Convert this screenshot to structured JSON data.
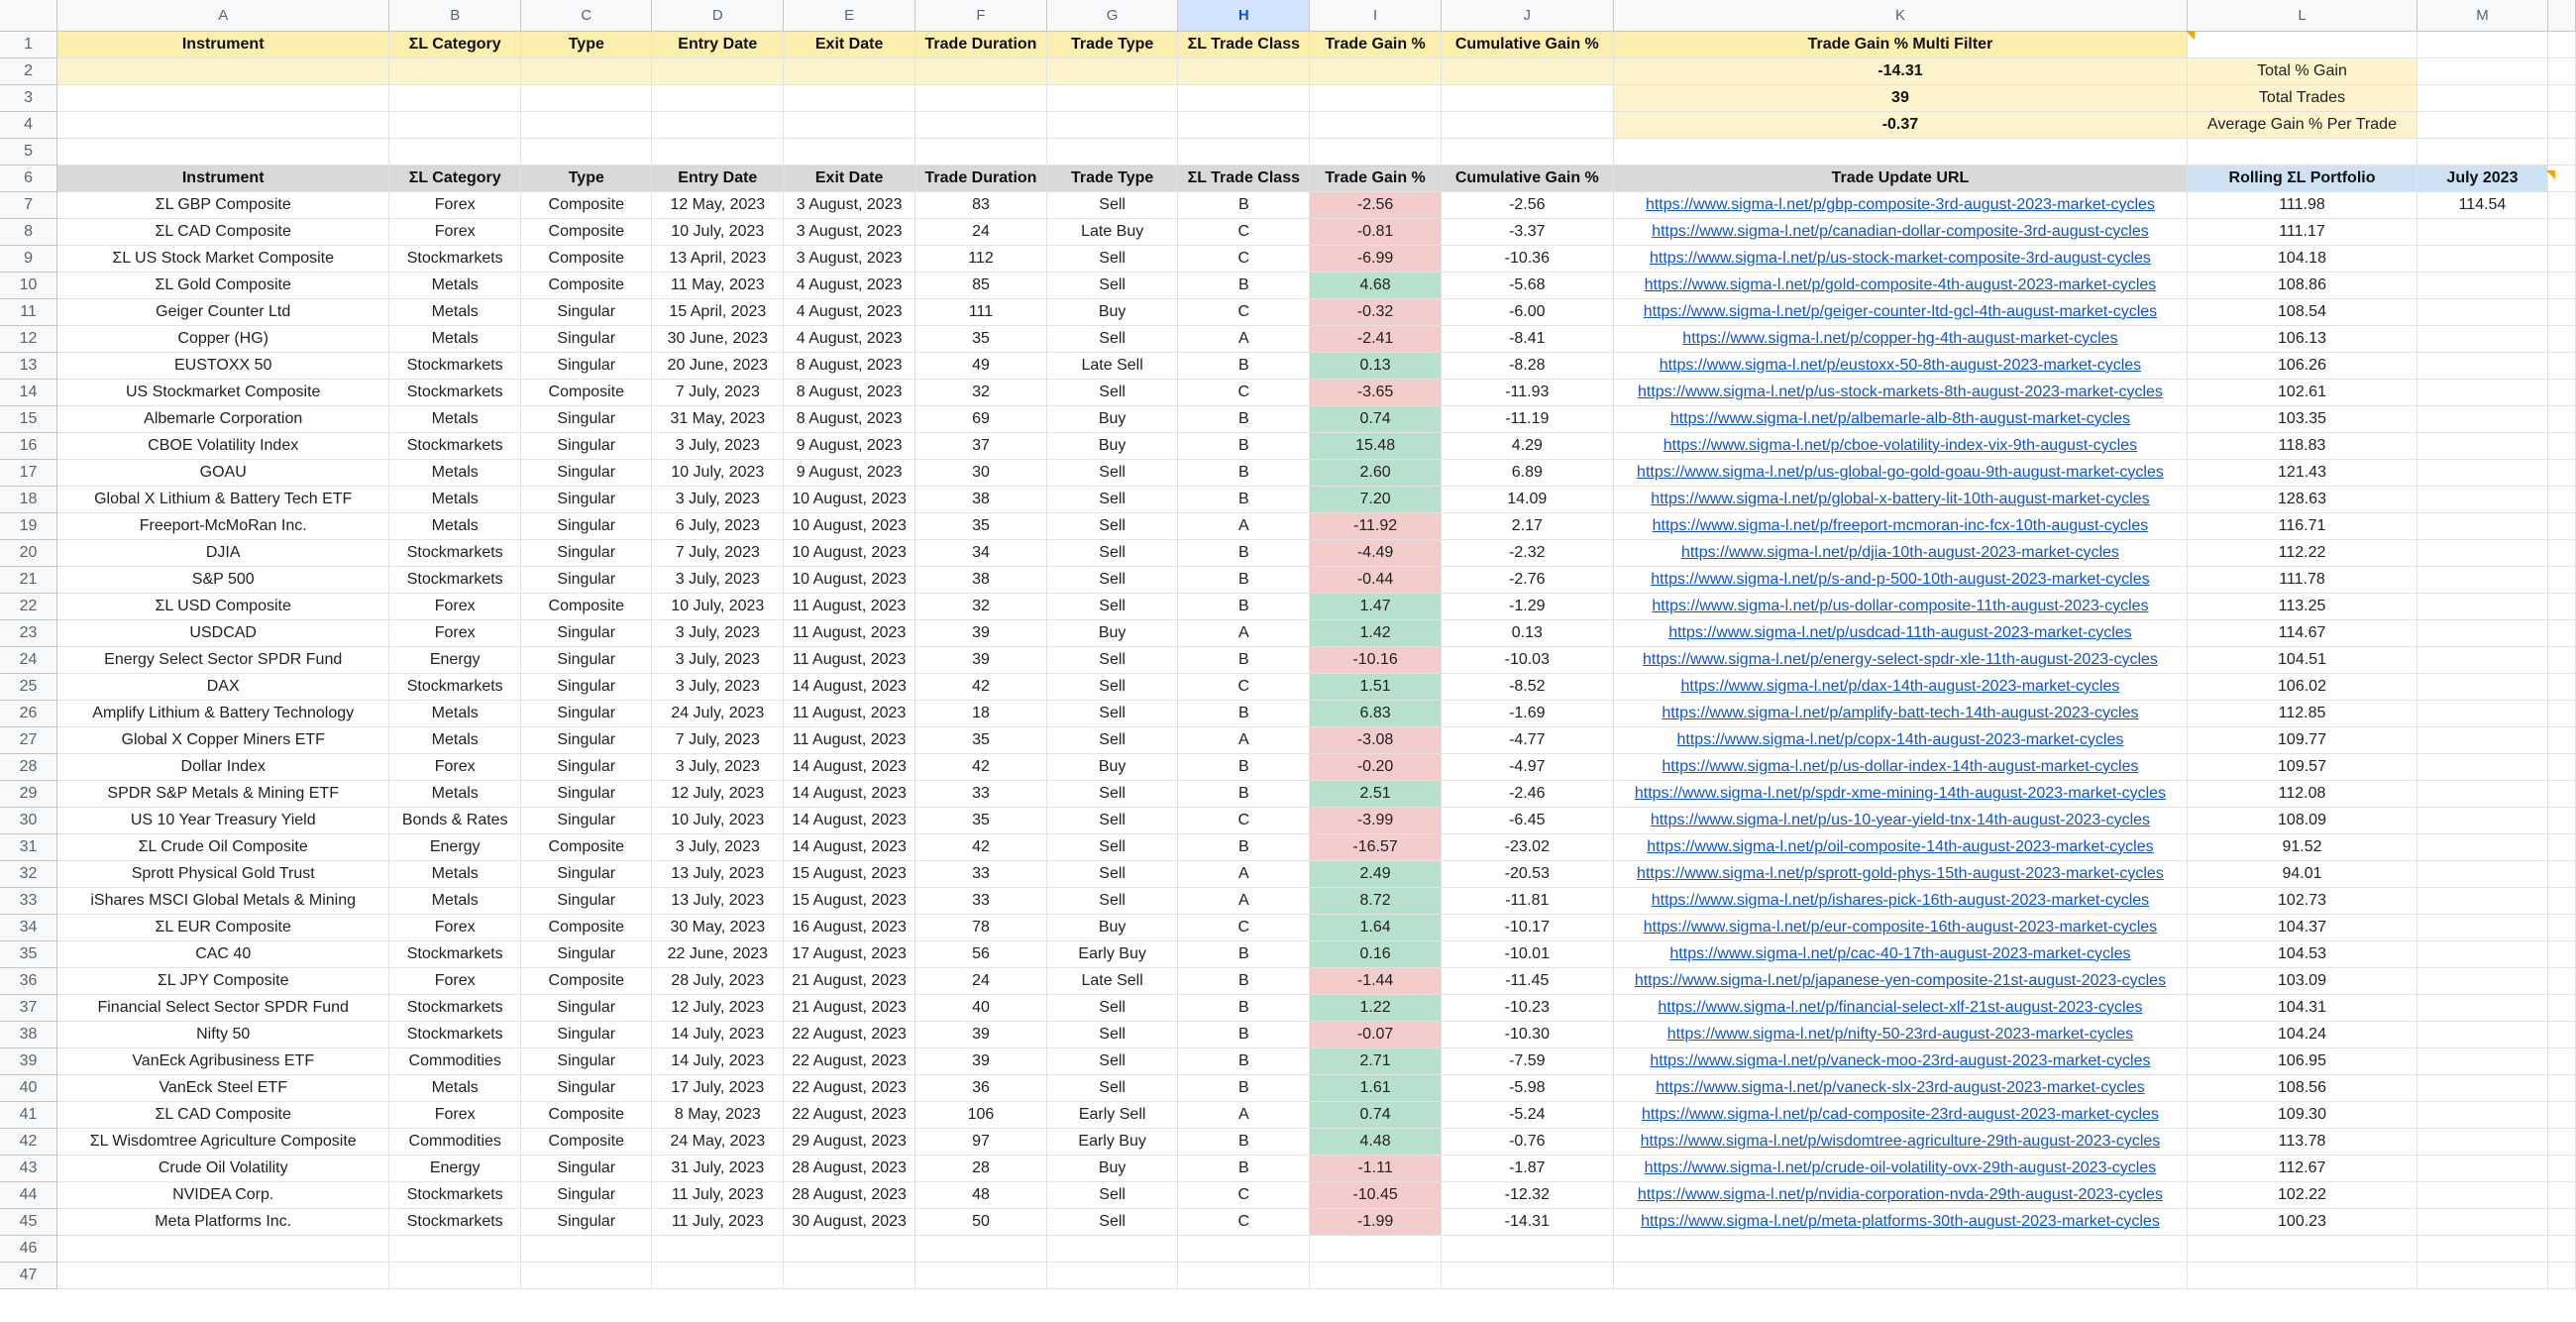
{
  "column_letters": [
    "A",
    "B",
    "C",
    "D",
    "E",
    "F",
    "G",
    "H",
    "I",
    "J",
    "K",
    "L",
    "M"
  ],
  "selected_column": "H",
  "header_row_1": [
    "Instrument",
    "ΣL Category",
    "Type",
    "Entry Date",
    "Exit Date",
    "Trade Duration",
    "Trade Type",
    "ΣL Trade Class",
    "Trade Gain %",
    "Cumulative Gain %",
    "Trade Gain % Multi Filter"
  ],
  "stats": [
    {
      "value": "-14.31",
      "label": "Total % Gain"
    },
    {
      "value": "39",
      "label": "Total Trades"
    },
    {
      "value": "-0.37",
      "label": "Average Gain % Per Trade"
    }
  ],
  "header_row_6": [
    "Instrument",
    "ΣL Category",
    "Type",
    "Entry Date",
    "Exit Date",
    "Trade Duration",
    "Trade Type",
    "ΣL Trade Class",
    "Trade Gain %",
    "Cumulative Gain %",
    "Trade Update URL",
    "Rolling ΣL Portfolio",
    "July 2023"
  ],
  "july_value": "114.54",
  "row_numbers_extra": [
    "46",
    "47"
  ],
  "colors": {
    "positive": "#b7e1cd",
    "negative": "#f4cccc",
    "header_yellow": "#fcefad",
    "link": "#1155cc",
    "selected_col": "#d3e3fd"
  },
  "trades": [
    [
      "ΣL GBP Composite",
      "Forex",
      "Composite",
      "12 May, 2023",
      "3 August, 2023",
      "83",
      "Sell",
      "B",
      "-2.56",
      "-2.56",
      "https://www.sigma-l.net/p/gbp-composite-3rd-august-2023-market-cycles",
      "111.98"
    ],
    [
      "ΣL CAD Composite",
      "Forex",
      "Composite",
      "10 July, 2023",
      "3 August, 2023",
      "24",
      "Late Buy",
      "C",
      "-0.81",
      "-3.37",
      "https://www.sigma-l.net/p/canadian-dollar-composite-3rd-august-cycles",
      "111.17"
    ],
    [
      "ΣL US Stock Market Composite",
      "Stockmarkets",
      "Composite",
      "13 April, 2023",
      "3 August, 2023",
      "112",
      "Sell",
      "C",
      "-6.99",
      "-10.36",
      "https://www.sigma-l.net/p/us-stock-market-composite-3rd-august-cycles",
      "104.18"
    ],
    [
      "ΣL Gold Composite",
      "Metals",
      "Composite",
      "11 May, 2023",
      "4 August, 2023",
      "85",
      "Sell",
      "B",
      "4.68",
      "-5.68",
      "https://www.sigma-l.net/p/gold-composite-4th-august-2023-market-cycles",
      "108.86"
    ],
    [
      "Geiger Counter Ltd",
      "Metals",
      "Singular",
      "15 April, 2023",
      "4 August, 2023",
      "111",
      "Buy",
      "C",
      "-0.32",
      "-6.00",
      "https://www.sigma-l.net/p/geiger-counter-ltd-gcl-4th-august-market-cycles",
      "108.54"
    ],
    [
      "Copper (HG)",
      "Metals",
      "Singular",
      "30 June, 2023",
      "4 August, 2023",
      "35",
      "Sell",
      "A",
      "-2.41",
      "-8.41",
      "https://www.sigma-l.net/p/copper-hg-4th-august-market-cycles",
      "106.13"
    ],
    [
      "EUSTOXX 50",
      "Stockmarkets",
      "Singular",
      "20 June, 2023",
      "8 August, 2023",
      "49",
      "Late Sell",
      "B",
      "0.13",
      "-8.28",
      "https://www.sigma-l.net/p/eustoxx-50-8th-august-2023-market-cycles",
      "106.26"
    ],
    [
      "US Stockmarket Composite",
      "Stockmarkets",
      "Composite",
      "7 July, 2023",
      "8 August, 2023",
      "32",
      "Sell",
      "C",
      "-3.65",
      "-11.93",
      "https://www.sigma-l.net/p/us-stock-markets-8th-august-2023-market-cycles",
      "102.61"
    ],
    [
      "Albemarle Corporation",
      "Metals",
      "Singular",
      "31 May, 2023",
      "8 August, 2023",
      "69",
      "Buy",
      "B",
      "0.74",
      "-11.19",
      "https://www.sigma-l.net/p/albemarle-alb-8th-august-market-cycles",
      "103.35"
    ],
    [
      "CBOE Volatility Index",
      "Stockmarkets",
      "Singular",
      "3 July, 2023",
      "9 August, 2023",
      "37",
      "Buy",
      "B",
      "15.48",
      "4.29",
      "https://www.sigma-l.net/p/cboe-volatility-index-vix-9th-august-cycles",
      "118.83"
    ],
    [
      "GOAU",
      "Metals",
      "Singular",
      "10 July, 2023",
      "9 August, 2023",
      "30",
      "Sell",
      "B",
      "2.60",
      "6.89",
      "https://www.sigma-l.net/p/us-global-go-gold-goau-9th-august-market-cycles",
      "121.43"
    ],
    [
      "Global X Lithium & Battery Tech ETF",
      "Metals",
      "Singular",
      "3 July, 2023",
      "10 August, 2023",
      "38",
      "Sell",
      "B",
      "7.20",
      "14.09",
      "https://www.sigma-l.net/p/global-x-battery-lit-10th-august-market-cycles",
      "128.63"
    ],
    [
      "Freeport-McMoRan Inc.",
      "Metals",
      "Singular",
      "6 July, 2023",
      "10 August, 2023",
      "35",
      "Sell",
      "A",
      "-11.92",
      "2.17",
      "https://www.sigma-l.net/p/freeport-mcmoran-inc-fcx-10th-august-cycles",
      "116.71"
    ],
    [
      "DJIA",
      "Stockmarkets",
      "Singular",
      "7 July, 2023",
      "10 August, 2023",
      "34",
      "Sell",
      "B",
      "-4.49",
      "-2.32",
      "https://www.sigma-l.net/p/djia-10th-august-2023-market-cycles",
      "112.22"
    ],
    [
      "S&P 500",
      "Stockmarkets",
      "Singular",
      "3 July, 2023",
      "10 August, 2023",
      "38",
      "Sell",
      "B",
      "-0.44",
      "-2.76",
      "https://www.sigma-l.net/p/s-and-p-500-10th-august-2023-market-cycles",
      "111.78"
    ],
    [
      "ΣL USD Composite",
      "Forex",
      "Composite",
      "10 July, 2023",
      "11 August, 2023",
      "32",
      "Sell",
      "B",
      "1.47",
      "-1.29",
      "https://www.sigma-l.net/p/us-dollar-composite-11th-august-2023-cycles",
      "113.25"
    ],
    [
      "USDCAD",
      "Forex",
      "Singular",
      "3 July, 2023",
      "11 August, 2023",
      "39",
      "Buy",
      "A",
      "1.42",
      "0.13",
      "https://www.sigma-l.net/p/usdcad-11th-august-2023-market-cycles",
      "114.67"
    ],
    [
      "Energy Select Sector SPDR Fund",
      "Energy",
      "Singular",
      "3 July, 2023",
      "11 August, 2023",
      "39",
      "Sell",
      "B",
      "-10.16",
      "-10.03",
      "https://www.sigma-l.net/p/energy-select-spdr-xle-11th-august-2023-cycles",
      "104.51"
    ],
    [
      "DAX",
      "Stockmarkets",
      "Singular",
      "3 July, 2023",
      "14 August, 2023",
      "42",
      "Sell",
      "C",
      "1.51",
      "-8.52",
      "https://www.sigma-l.net/p/dax-14th-august-2023-market-cycles",
      "106.02"
    ],
    [
      "Amplify Lithium & Battery Technology",
      "Metals",
      "Singular",
      "24 July, 2023",
      "11 August, 2023",
      "18",
      "Sell",
      "B",
      "6.83",
      "-1.69",
      "https://www.sigma-l.net/p/amplify-batt-tech-14th-august-2023-cycles",
      "112.85"
    ],
    [
      "Global X Copper Miners ETF",
      "Metals",
      "Singular",
      "7 July, 2023",
      "11 August, 2023",
      "35",
      "Sell",
      "A",
      "-3.08",
      "-4.77",
      "https://www.sigma-l.net/p/copx-14th-august-2023-market-cycles",
      "109.77"
    ],
    [
      "Dollar Index",
      "Forex",
      "Singular",
      "3 July, 2023",
      "14 August, 2023",
      "42",
      "Buy",
      "B",
      "-0.20",
      "-4.97",
      "https://www.sigma-l.net/p/us-dollar-index-14th-august-market-cycles",
      "109.57"
    ],
    [
      "SPDR S&P Metals & Mining ETF",
      "Metals",
      "Singular",
      "12 July, 2023",
      "14 August, 2023",
      "33",
      "Sell",
      "B",
      "2.51",
      "-2.46",
      "https://www.sigma-l.net/p/spdr-xme-mining-14th-august-2023-market-cycles",
      "112.08"
    ],
    [
      "US 10 Year Treasury Yield",
      "Bonds & Rates",
      "Singular",
      "10 July, 2023",
      "14 August, 2023",
      "35",
      "Sell",
      "C",
      "-3.99",
      "-6.45",
      "https://www.sigma-l.net/p/us-10-year-yield-tnx-14th-august-2023-cycles",
      "108.09"
    ],
    [
      "ΣL Crude Oil Composite",
      "Energy",
      "Composite",
      "3 July, 2023",
      "14 August, 2023",
      "42",
      "Sell",
      "B",
      "-16.57",
      "-23.02",
      "https://www.sigma-l.net/p/oil-composite-14th-august-2023-market-cycles",
      "91.52"
    ],
    [
      "Sprott Physical Gold Trust",
      "Metals",
      "Singular",
      "13 July, 2023",
      "15 August, 2023",
      "33",
      "Sell",
      "A",
      "2.49",
      "-20.53",
      "https://www.sigma-l.net/p/sprott-gold-phys-15th-august-2023-market-cycles",
      "94.01"
    ],
    [
      "iShares MSCI Global Metals & Mining",
      "Metals",
      "Singular",
      "13 July, 2023",
      "15 August, 2023",
      "33",
      "Sell",
      "A",
      "8.72",
      "-11.81",
      "https://www.sigma-l.net/p/ishares-pick-16th-august-2023-market-cycles",
      "102.73"
    ],
    [
      "ΣL EUR Composite",
      "Forex",
      "Composite",
      "30 May, 2023",
      "16 August, 2023",
      "78",
      "Buy",
      "C",
      "1.64",
      "-10.17",
      "https://www.sigma-l.net/p/eur-composite-16th-august-2023-market-cycles",
      "104.37"
    ],
    [
      "CAC 40",
      "Stockmarkets",
      "Singular",
      "22 June, 2023",
      "17 August, 2023",
      "56",
      "Early Buy",
      "B",
      "0.16",
      "-10.01",
      "https://www.sigma-l.net/p/cac-40-17th-august-2023-market-cycles",
      "104.53"
    ],
    [
      "ΣL JPY Composite",
      "Forex",
      "Composite",
      "28 July, 2023",
      "21 August, 2023",
      "24",
      "Late Sell",
      "B",
      "-1.44",
      "-11.45",
      "https://www.sigma-l.net/p/japanese-yen-composite-21st-august-2023-cycles",
      "103.09"
    ],
    [
      "Financial Select Sector SPDR Fund",
      "Stockmarkets",
      "Singular",
      "12 July, 2023",
      "21 August, 2023",
      "40",
      "Sell",
      "B",
      "1.22",
      "-10.23",
      "https://www.sigma-l.net/p/financial-select-xlf-21st-august-2023-cycles",
      "104.31"
    ],
    [
      "Nifty 50",
      "Stockmarkets",
      "Singular",
      "14 July, 2023",
      "22 August, 2023",
      "39",
      "Sell",
      "B",
      "-0.07",
      "-10.30",
      "https://www.sigma-l.net/p/nifty-50-23rd-august-2023-market-cycles",
      "104.24"
    ],
    [
      "VanEck Agribusiness ETF",
      "Commodities",
      "Singular",
      "14 July, 2023",
      "22 August, 2023",
      "39",
      "Sell",
      "B",
      "2.71",
      "-7.59",
      "https://www.sigma-l.net/p/vaneck-moo-23rd-august-2023-market-cycles",
      "106.95"
    ],
    [
      "VanEck Steel ETF",
      "Metals",
      "Singular",
      "17 July, 2023",
      "22 August, 2023",
      "36",
      "Sell",
      "B",
      "1.61",
      "-5.98",
      "https://www.sigma-l.net/p/vaneck-slx-23rd-august-2023-market-cycles",
      "108.56"
    ],
    [
      "ΣL CAD Composite",
      "Forex",
      "Composite",
      "8 May, 2023",
      "22 August, 2023",
      "106",
      "Early Sell",
      "A",
      "0.74",
      "-5.24",
      "https://www.sigma-l.net/p/cad-composite-23rd-august-2023-market-cycles",
      "109.30"
    ],
    [
      "ΣL Wisdomtree Agriculture Composite",
      "Commodities",
      "Composite",
      "24 May, 2023",
      "29 August, 2023",
      "97",
      "Early Buy",
      "B",
      "4.48",
      "-0.76",
      "https://www.sigma-l.net/p/wisdomtree-agriculture-29th-august-2023-cycles",
      "113.78"
    ],
    [
      "Crude Oil Volatility",
      "Energy",
      "Singular",
      "31 July, 2023",
      "28 August, 2023",
      "28",
      "Buy",
      "B",
      "-1.11",
      "-1.87",
      "https://www.sigma-l.net/p/crude-oil-volatility-ovx-29th-august-2023-cycles",
      "112.67"
    ],
    [
      "NVIDEA Corp.",
      "Stockmarkets",
      "Singular",
      "11 July, 2023",
      "28 August, 2023",
      "48",
      "Sell",
      "C",
      "-10.45",
      "-12.32",
      "https://www.sigma-l.net/p/nvidia-corporation-nvda-29th-august-2023-cycles",
      "102.22"
    ],
    [
      "Meta Platforms Inc.",
      "Stockmarkets",
      "Singular",
      "11 July, 2023",
      "30 August, 2023",
      "50",
      "Sell",
      "C",
      "-1.99",
      "-14.31",
      "https://www.sigma-l.net/p/meta-platforms-30th-august-2023-market-cycles",
      "100.23"
    ]
  ]
}
